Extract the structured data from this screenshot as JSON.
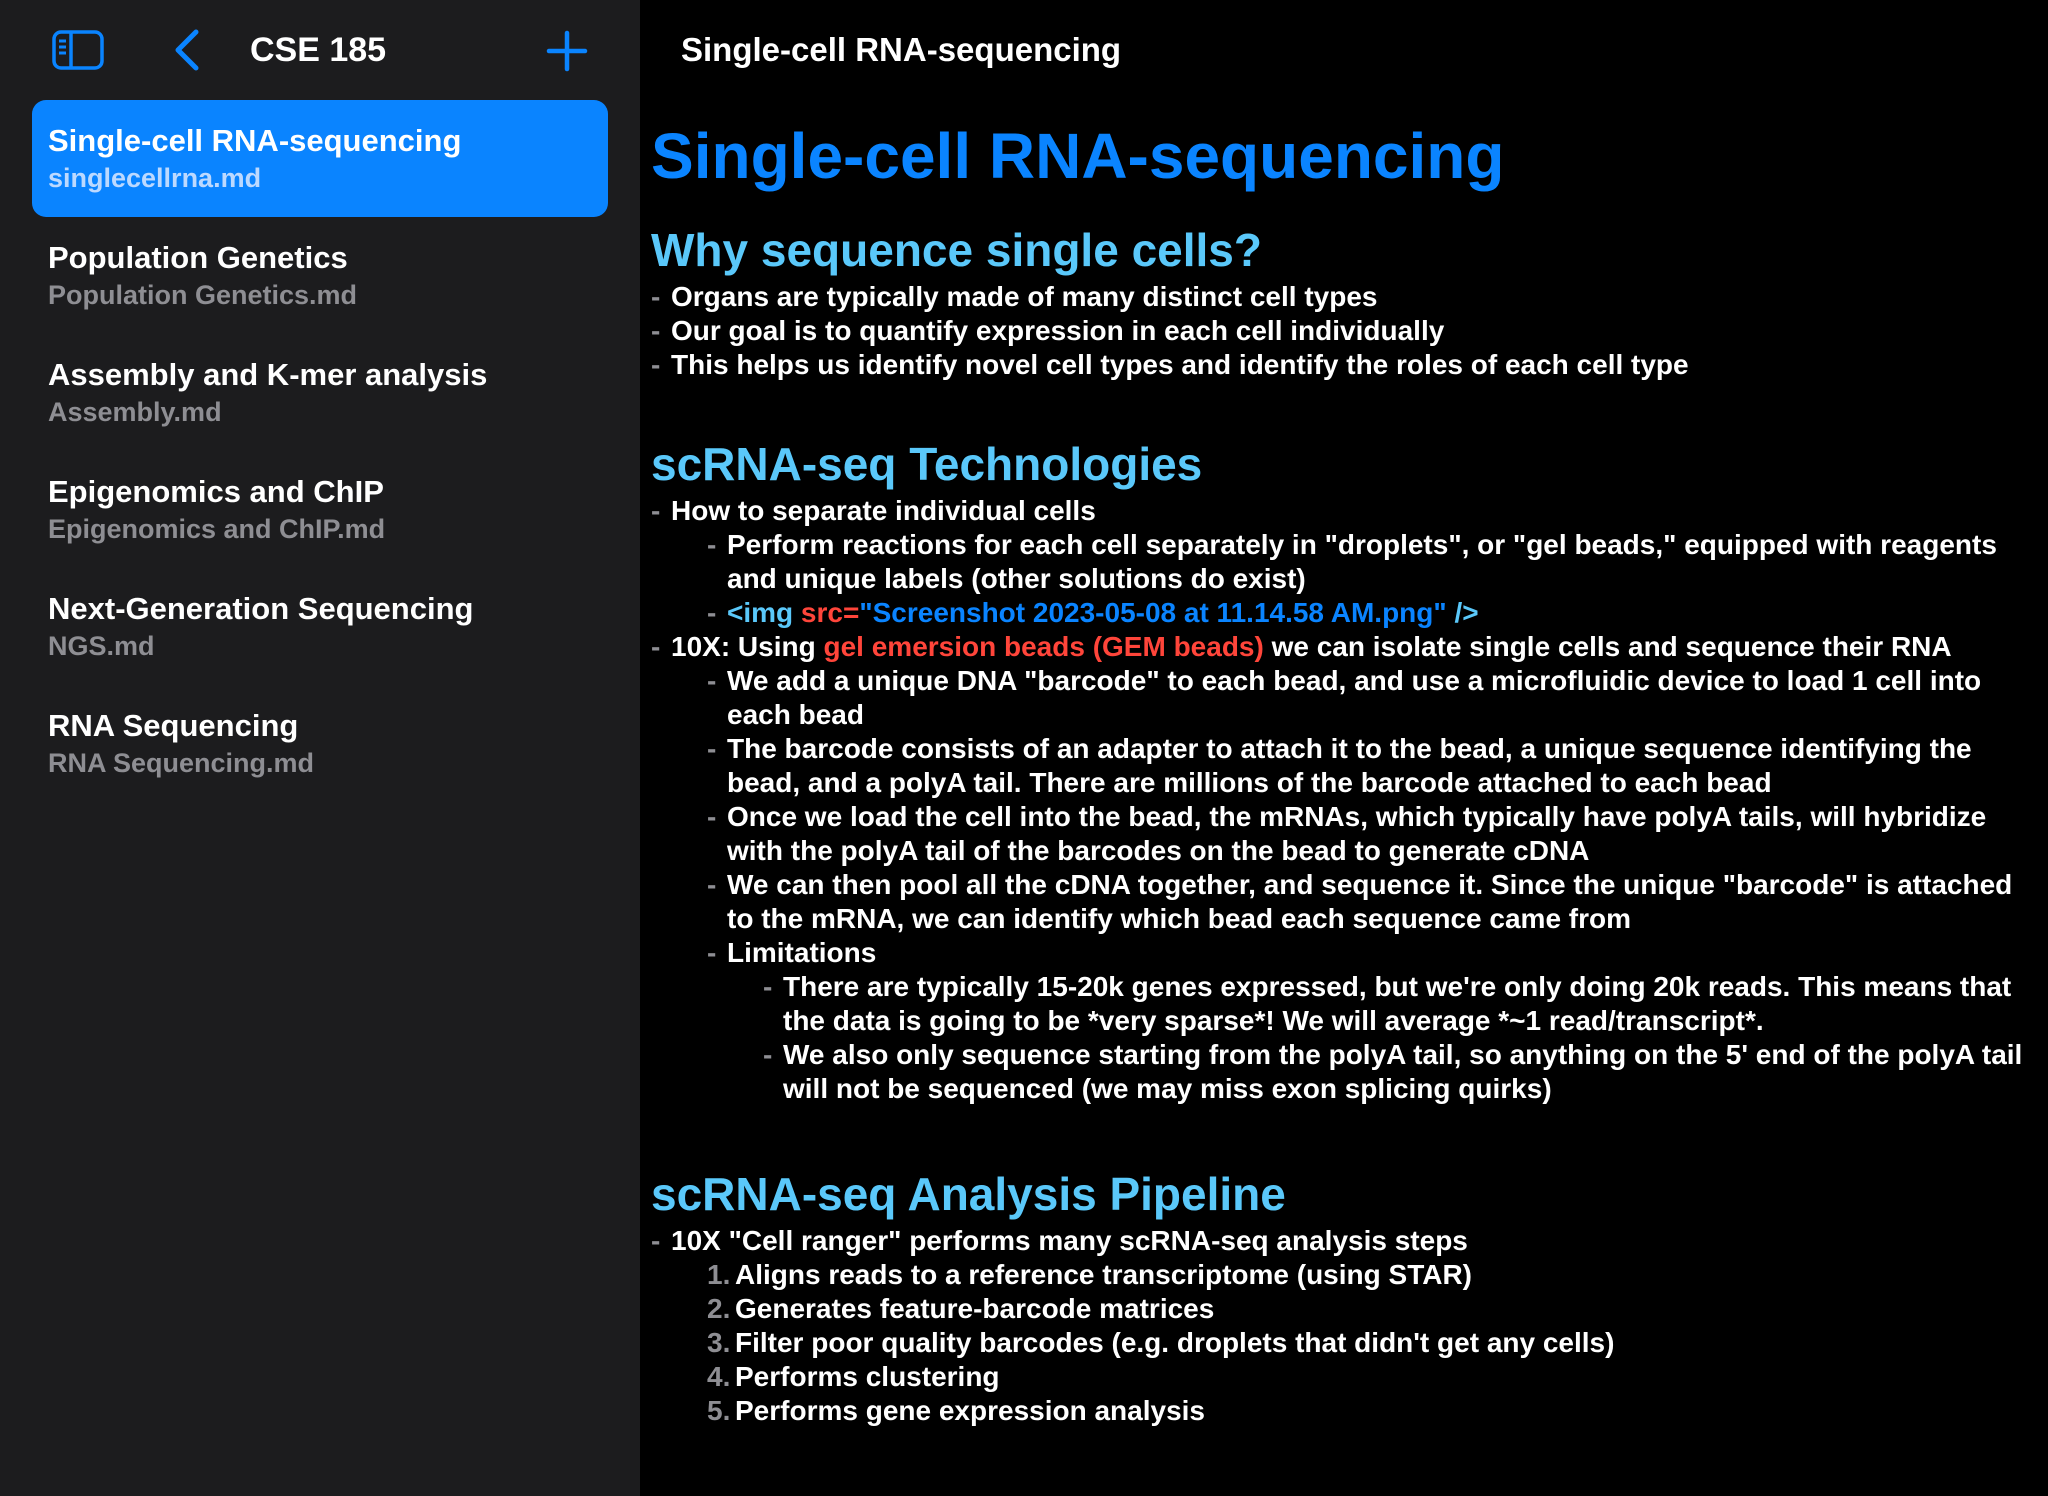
{
  "sidebar": {
    "title": "CSE 185",
    "documents": [
      {
        "title": "Single-cell RNA-sequencing",
        "file": "singlecellrna.md",
        "selected": true
      },
      {
        "title": "Population Genetics",
        "file": "Population Genetics.md",
        "selected": false
      },
      {
        "title": "Assembly and K-mer analysis",
        "file": "Assembly.md",
        "selected": false
      },
      {
        "title": "Epigenomics and ChIP",
        "file": "Epigenomics and ChIP.md",
        "selected": false
      },
      {
        "title": "Next-Generation Sequencing",
        "file": "NGS.md",
        "selected": false
      },
      {
        "title": "RNA Sequencing",
        "file": "RNA Sequencing.md",
        "selected": false
      }
    ]
  },
  "main": {
    "header_title": "Single-cell RNA-sequencing",
    "h1": "Single-cell RNA-sequencing",
    "s1": {
      "heading": "Why sequence single cells?",
      "bullets": [
        "Organs are typically made of many distinct cell types",
        "Our goal is to quantify expression in each cell individually",
        "This helps us identify novel cell types and identify the roles of each cell type"
      ]
    },
    "s2": {
      "heading": "scRNA-seq Technologies",
      "b1": "How to separate individual cells",
      "b1_1": "Perform reactions for each cell separately in \"droplets\", or \"gel beads,\" equipped with reagents and unique labels (other solutions do exist)",
      "img_tag_open": "<img ",
      "img_attr": "src=",
      "img_value": "\"Screenshot 2023-05-08 at 11.14.58 AM.png\"",
      "img_tag_close": " />",
      "b2_pre": "10X: Using ",
      "b2_em": "gel emersion beads (GEM beads)",
      "b2_post": " we can isolate single cells and sequence their RNA",
      "b2_1": "We add a unique DNA \"barcode\" to each bead, and use a microfluidic device to load 1 cell into each bead",
      "b2_2": "The barcode consists of an adapter to attach it to the bead, a unique sequence identifying the bead, and a polyA tail. There are millions of the barcode attached to each bead",
      "b2_3": "Once we load the cell into the bead, the mRNAs, which typically have polyA tails, will hybridize with the polyA tail of the barcodes on the bead to generate cDNA",
      "b2_4": "We can then pool all the cDNA together, and sequence it. Since the unique \"barcode\" is attached to the mRNA, we can identify which bead each sequence came from",
      "b2_5": "Limitations",
      "b2_5_1": "There are typically 15-20k genes expressed, but we're only doing 20k reads. This means that the data is going to be *very sparse*! We will average *~1 read/transcript*.",
      "b2_5_2": "We also only sequence starting from the polyA tail, so anything on the 5' end of the polyA tail will not be sequenced (we may miss exon splicing quirks)"
    },
    "s3": {
      "heading": "scRNA-seq Analysis Pipeline",
      "b1": "10X \"Cell ranger\" performs many scRNA-seq analysis steps",
      "steps": [
        {
          "num": "1.",
          "text": "Aligns reads to a reference transcriptome (using STAR)"
        },
        {
          "num": "2.",
          "text": "Generates feature-barcode matrices"
        },
        {
          "num": "3.",
          "text": "Filter poor quality barcodes (e.g. droplets that didn't get any cells)"
        },
        {
          "num": "4.",
          "text": "Performs clustering"
        },
        {
          "num": "5.",
          "text": "Performs gene expression analysis"
        }
      ]
    }
  },
  "colors": {
    "accent": "#0a84ff",
    "heading2": "#5ac8fa",
    "emphasis": "#ff453a",
    "sidebar_bg": "#1c1c1e",
    "main_bg": "#000000"
  },
  "icons": [
    "sidebar-toggle-icon",
    "chevron-left-icon",
    "plus-icon"
  ]
}
